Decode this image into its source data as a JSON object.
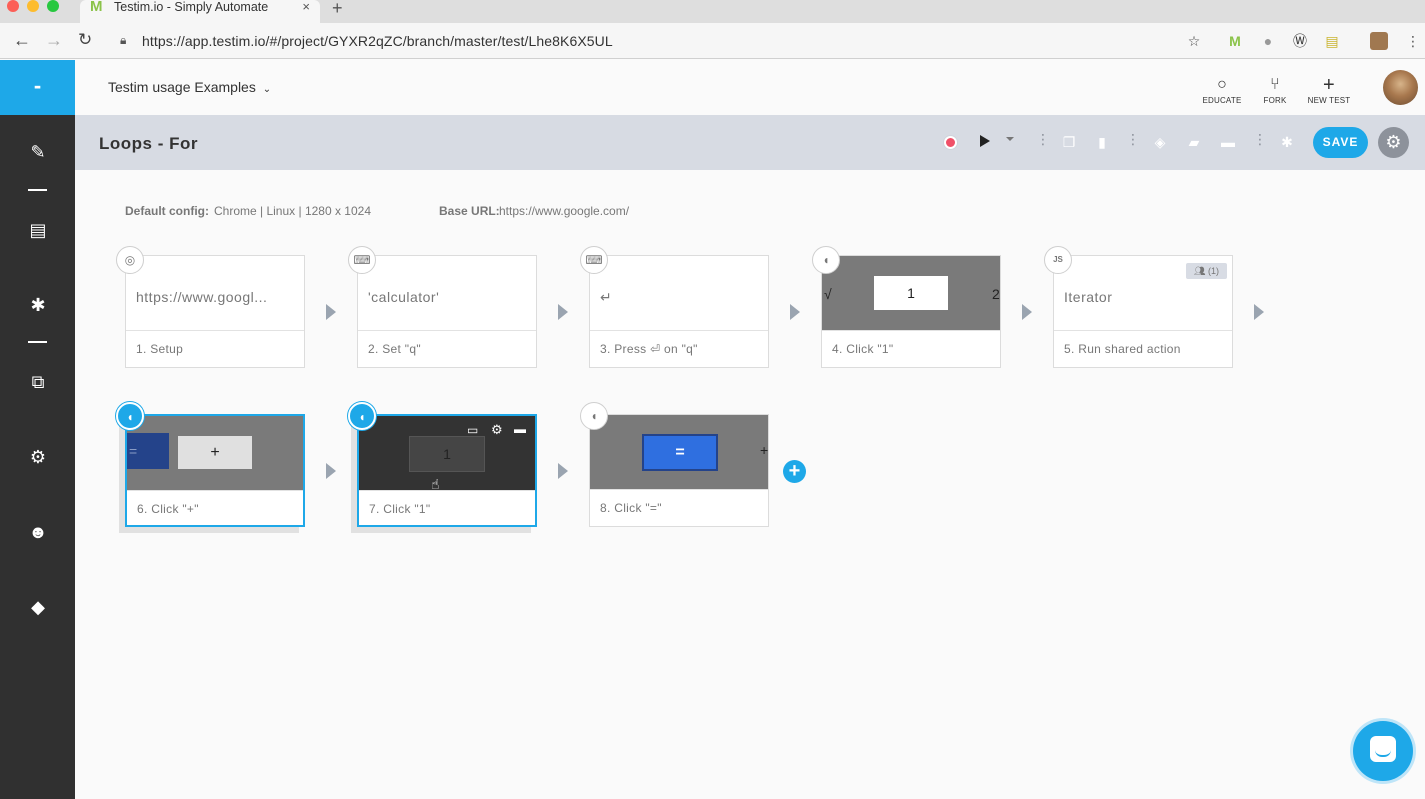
{
  "browser": {
    "tab_title": "Testim.io - Simply Automate",
    "tab_close": "×",
    "new_tab": "+",
    "url": "https://app.testim.io/#/project/GYXR2qZC/branch/master/test/Lhe8K6X5UL"
  },
  "sidebar": {
    "logo": "-"
  },
  "topbar": {
    "project_name": "Testim usage Examples",
    "educate_label": "EDUCATE",
    "fork_label": "FORK",
    "new_test_label": "NEW TEST"
  },
  "test_header": {
    "title": "Loops - For",
    "save_label": "SAVE"
  },
  "config": {
    "default_config_label": "Default config:",
    "default_config_value": "Chrome | Linux | 1280 x 1024",
    "base_url_label": "Base URL:",
    "base_url_value": "https://www.google.com/"
  },
  "steps": [
    {
      "label": "1. Setup",
      "thumb_text": "https://www.googl..."
    },
    {
      "label": "2. Set \"q\"",
      "thumb_text": "'calculator'"
    },
    {
      "label": "3. Press ⏎ on \"q\"",
      "thumb_text": "↵"
    },
    {
      "label": "4. Click \"1\"",
      "thumb_text": "1",
      "thumb_left": "√",
      "thumb_right": "2"
    },
    {
      "label": "5. Run shared action",
      "thumb_text": "Iterator",
      "shared_badge": "(1)"
    },
    {
      "label": "6. Click \"+\"",
      "thumb_text": "+",
      "thumb_left": "="
    },
    {
      "label": "7. Click \"1\"",
      "thumb_text": "1"
    },
    {
      "label": "8. Click \"=\"",
      "thumb_text": "=",
      "thumb_right": "+"
    }
  ],
  "step_badges": {
    "js": "JS"
  },
  "add_step": "+"
}
